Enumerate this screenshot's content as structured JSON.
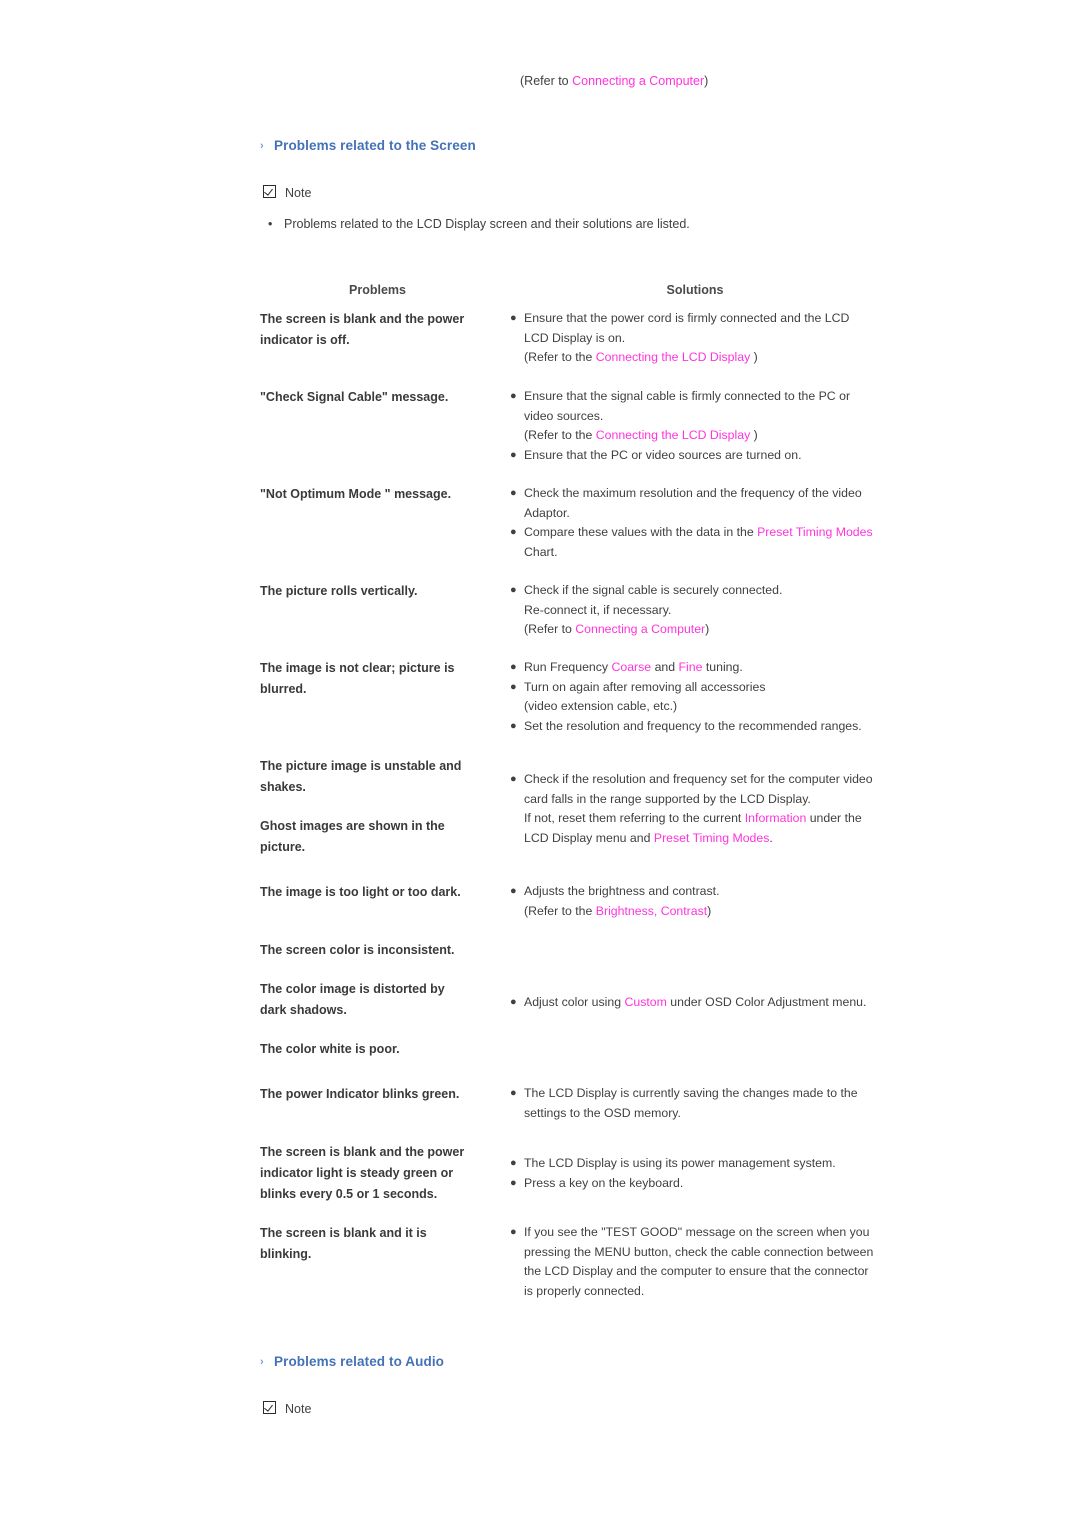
{
  "colors": {
    "link": "#ff33dd",
    "heading": "#4472b8",
    "body_text": "#404040",
    "table_header": "#4a4a4a"
  },
  "top_refer": {
    "prefix": "(Refer to ",
    "link": "Connecting a Computer",
    "suffix": ")"
  },
  "section_screen": {
    "heading": "Problems related to the Screen",
    "note_label": "Note",
    "note_bullet": "Problems related to the LCD Display screen and their solutions are listed."
  },
  "section_audio": {
    "heading": "Problems related to Audio",
    "note_label": "Note"
  },
  "table": {
    "header": {
      "problems": "Problems",
      "solutions": "Solutions"
    },
    "rows": [
      {
        "problem": [
          "The screen is blank and the power",
          "indicator is off."
        ],
        "solutions": [
          {
            "lines": [
              [
                {
                  "t": "Ensure that the power cord is firmly connected and the LCD"
                }
              ],
              [
                {
                  "t": "LCD Display is on."
                }
              ],
              [
                {
                  "t": "(Refer to the "
                },
                {
                  "t": "Connecting the LCD Display",
                  "link": true
                },
                {
                  "t": " )"
                }
              ]
            ]
          }
        ]
      },
      {
        "problem": [
          "\"Check Signal Cable\" message."
        ],
        "solutions": [
          {
            "lines": [
              [
                {
                  "t": "Ensure that the signal cable is firmly connected to the PC or"
                }
              ],
              [
                {
                  "t": "video sources."
                }
              ],
              [
                {
                  "t": "(Refer to the "
                },
                {
                  "t": "Connecting the LCD Display",
                  "link": true
                },
                {
                  "t": " )"
                }
              ]
            ]
          },
          {
            "lines": [
              [
                {
                  "t": "Ensure that the PC or video sources are turned on."
                }
              ]
            ]
          }
        ]
      },
      {
        "problem": [
          "\"Not Optimum Mode \" message."
        ],
        "solutions": [
          {
            "lines": [
              [
                {
                  "t": "Check the maximum resolution and the frequency of the video"
                }
              ],
              [
                {
                  "t": "Adaptor."
                }
              ]
            ]
          },
          {
            "lines": [
              [
                {
                  "t": "Compare these values with the data in the "
                },
                {
                  "t": "Preset Timing Modes",
                  "link": true
                }
              ],
              [
                {
                  "t": "Chart."
                }
              ]
            ]
          }
        ]
      },
      {
        "problem": [
          "The picture rolls vertically."
        ],
        "solutions": [
          {
            "lines": [
              [
                {
                  "t": "Check if the signal cable is securely connected."
                }
              ],
              [
                {
                  "t": "Re-connect it, if necessary."
                }
              ],
              [
                {
                  "t": "(Refer to "
                },
                {
                  "t": "Connecting a Computer",
                  "link": true
                },
                {
                  "t": ")"
                }
              ]
            ]
          }
        ]
      },
      {
        "problem": [
          "The image is not clear; picture is",
          "blurred."
        ],
        "solutions": [
          {
            "lines": [
              [
                {
                  "t": "Run Frequency "
                },
                {
                  "t": "Coarse",
                  "link": true
                },
                {
                  "t": " and "
                },
                {
                  "t": "Fine",
                  "link": true
                },
                {
                  "t": " tuning."
                }
              ]
            ]
          },
          {
            "lines": [
              [
                {
                  "t": "Turn on again after removing all accessories"
                }
              ],
              [
                {
                  "t": "(video extension cable, etc.)"
                }
              ]
            ]
          },
          {
            "lines": [
              [
                {
                  "t": "Set the resolution and frequency to the recommended ranges."
                }
              ]
            ]
          }
        ]
      },
      {
        "problem": [
          "The picture image is unstable and",
          "shakes.",
          "",
          "Ghost images are shown in the",
          "picture."
        ],
        "solutions": [
          {
            "lines": [
              [
                {
                  "t": "Check if the resolution and frequency set for the computer video"
                }
              ],
              [
                {
                  "t": "card falls in the range supported by the LCD Display."
                }
              ],
              [
                {
                  "t": "If not, reset them referring to the current "
                },
                {
                  "t": "Information",
                  "link": true
                },
                {
                  "t": " under the"
                }
              ],
              [
                {
                  "t": "LCD Display menu and "
                },
                {
                  "t": "Preset Timing Modes",
                  "link": true
                },
                {
                  "t": "."
                }
              ]
            ]
          }
        ]
      },
      {
        "problem": [
          "The image is too light or too dark."
        ],
        "solutions": [
          {
            "lines": [
              [
                {
                  "t": "Adjusts the brightness and contrast."
                }
              ],
              [
                {
                  "t": "(Refer to the "
                },
                {
                  "t": "Brightness, Contrast",
                  "link": true
                },
                {
                  "t": ")"
                }
              ]
            ]
          }
        ]
      },
      {
        "problem": [
          "The screen color is inconsistent.",
          "",
          "The color image is distorted by",
          "dark shadows.",
          "",
          "The color white is poor."
        ],
        "solutions": [
          {
            "lines": [
              [
                {
                  "t": "Adjust color using "
                },
                {
                  "t": "Custom",
                  "link": true
                },
                {
                  "t": " under OSD Color Adjustment menu."
                }
              ]
            ]
          }
        ]
      },
      {
        "problem": [
          "The power Indicator blinks green."
        ],
        "solutions": [
          {
            "lines": [
              [
                {
                  "t": "The LCD Display is currently saving the changes made to the"
                }
              ],
              [
                {
                  "t": "settings to the OSD memory."
                }
              ]
            ]
          }
        ]
      },
      {
        "problem": [
          "The screen is blank and the power",
          "indicator light is steady green or",
          "blinks every 0.5 or 1 seconds."
        ],
        "solutions": [
          {
            "lines": [
              [
                {
                  "t": "The LCD Display is using its power management system."
                }
              ]
            ]
          },
          {
            "lines": [
              [
                {
                  "t": "Press a key on the keyboard."
                }
              ]
            ]
          }
        ]
      },
      {
        "problem": [
          "The screen is blank and it is",
          "blinking."
        ],
        "solutions": [
          {
            "lines": [
              [
                {
                  "t": "If you see the \"TEST GOOD\" message on the screen when you"
                }
              ],
              [
                {
                  "t": "pressing the MENU button, check the cable connection between"
                }
              ],
              [
                {
                  "t": "the LCD Display and the computer to ensure that the connector"
                }
              ],
              [
                {
                  "t": "is properly connected."
                }
              ]
            ]
          }
        ]
      }
    ]
  }
}
